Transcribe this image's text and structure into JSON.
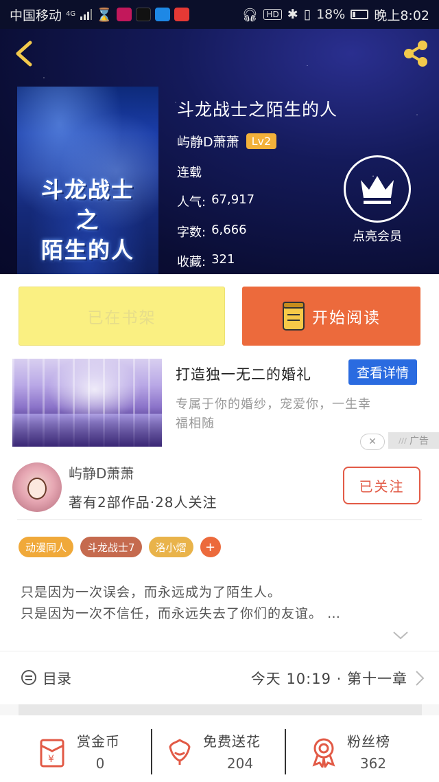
{
  "status_bar": {
    "carrier": "中国移动",
    "signal": "4G",
    "battery": "18%",
    "time": "晚上8:02"
  },
  "header": {
    "back_icon": "chevron-left-icon",
    "share_icon": "share-icon",
    "cover_title_line1": "斗龙战士",
    "cover_title_line2": "之",
    "cover_title_line3": "陌生的人",
    "title": "斗龙战士之陌生的人",
    "author": "屿静D萧萧",
    "level": "Lv2",
    "status": "连载",
    "popularity_label": "人气:",
    "popularity": "67,917",
    "words_label": "字数:",
    "words": "6,666",
    "collect_label": "收藏:",
    "collect": "321",
    "vip_label": "点亮会员"
  },
  "actions": {
    "shelf_label": "已在书架",
    "read_label": "开始阅读"
  },
  "ad": {
    "title": "打造独一无二的婚礼",
    "detail_button": "查看详情",
    "desc_line1": "专属于你的婚纱，宠爱你，一生幸",
    "desc_line2": "福相随",
    "close": "✕",
    "tag": "广告"
  },
  "author_card": {
    "name": "屿静D萧萧",
    "meta": "著有2部作品·28人关注",
    "follow_label": "已关注"
  },
  "tags": [
    {
      "label": "动漫同人",
      "color": "#f0a93a"
    },
    {
      "label": "斗龙战士7",
      "color": "#c56a4e"
    },
    {
      "label": "洛小熠",
      "color": "#e9b34a"
    }
  ],
  "tag_add": "+",
  "description": {
    "line1": "只是因为一次误会，而永远成为了陌生人。",
    "line2": "只是因为一次不信任，而永远失去了你们的友谊。 …"
  },
  "catalog": {
    "label": "目录",
    "latest": "今天  10:19 · 第十一章"
  },
  "bottom": {
    "reward_label": "赏金币",
    "reward_count": "0",
    "flower_label": "免费送花",
    "flower_count": "204",
    "fans_label": "粉丝榜",
    "fans_count": "362"
  },
  "colors": {
    "accent_orange": "#ec6a3c",
    "shelf_yellow": "#faf082",
    "follow_red": "#e25a46",
    "ad_blue": "#2a6be0"
  }
}
